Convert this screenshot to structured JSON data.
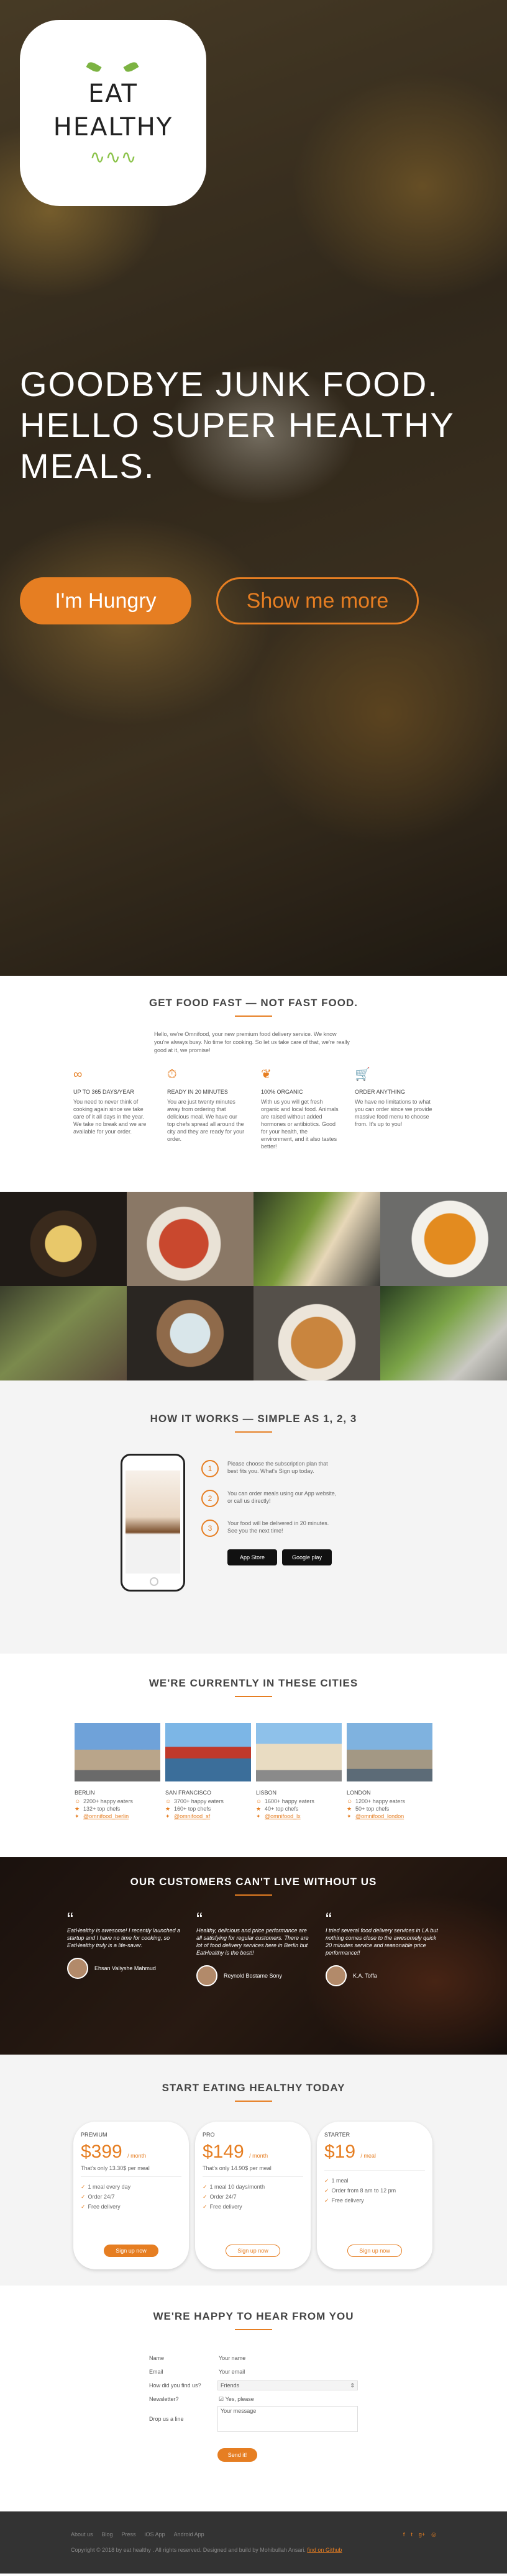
{
  "logo": {
    "line1": "EAT",
    "line2": "HEALTHY"
  },
  "hero": {
    "title": "GOODBYE JUNK FOOD. HELLO SUPER HEALTHY MEALS.",
    "primary_btn": "I'm Hungry",
    "secondary_btn": "Show me more"
  },
  "features": {
    "title": "Get food fast — not fast food.",
    "intro": "Hello, we're Omnifood, your new premium food delivery service. We know you're always busy. No time for cooking. So let us take care of that, we're really good at it, we promise!",
    "items": [
      {
        "icon": "infinity-icon",
        "glyph": "∞",
        "heading": "UP TO 365 DAYS/YEAR",
        "text": "You need to never think of cooking again since we take care of it all days in the year. We take no break and we are available for your order."
      },
      {
        "icon": "stopwatch-icon",
        "glyph": "⏱",
        "heading": "READY IN 20 MINUTES",
        "text": "You are just twenty minutes away from ordering that delicious meal. We have our top chefs spread all around the city and they are ready for your order."
      },
      {
        "icon": "leaf-icon",
        "glyph": "❦",
        "heading": "100% ORGANIC",
        "text": "With us you will get fresh organic and local food. Animals are raised without added hormones or antibiotics. Good for your health, the environment, and it also tastes better!"
      },
      {
        "icon": "cart-icon",
        "glyph": "🛒",
        "heading": "ORDER ANYTHING",
        "text": "We have no limitations to what you can order since we provide massive food menu to choose from. It's up to you!"
      }
    ]
  },
  "how": {
    "title": "How it works — Simple as 1, 2, 3",
    "steps": [
      {
        "num": "1",
        "text": "Please choose the subscription plan that best fits you. What's Sign up today."
      },
      {
        "num": "2",
        "text": "You can order meals using our App website, or call us directly!"
      },
      {
        "num": "3",
        "text": "Your food will be delivered in 20 minutes. See you the next time!"
      }
    ],
    "app_store": "App Store",
    "google_play": "Google play"
  },
  "cities": {
    "title": "We're currently in these cities",
    "items": [
      {
        "name": "BERLIN",
        "users": "2200+ happy eaters",
        "chefs": "132+ top chefs",
        "handle": "@omnifood_berlin"
      },
      {
        "name": "SAN FRANCISCO",
        "users": "3700+ happy eaters",
        "chefs": "160+ top chefs",
        "handle": "@omnifood_sf"
      },
      {
        "name": "LISBON",
        "users": "1600+ happy eaters",
        "chefs": "40+ top chefs",
        "handle": "@omnifood_lx"
      },
      {
        "name": "LONDON",
        "users": "1200+ happy eaters",
        "chefs": "50+ top chefs",
        "handle": "@omnifood_london"
      }
    ]
  },
  "testimonials": {
    "title": "Our customers can't live without us",
    "items": [
      {
        "quote": "EatHealthy is awesome! I recently launched a startup and I have no time for cooking, so EatHealthy truly is a life-saver.",
        "author": "Ehsan Valiyshe Mahmud"
      },
      {
        "quote": "Healthy, delicious and price performance are all satisfying for regular customers. There are lot of food delivery services here in Berlin but EatHealthy is the best!!",
        "author": "Reynold Bostame Sony"
      },
      {
        "quote": "I tried several food delivery services in LA but nothing comes close to the awesomely quick 20 minutes service and reasonable price performance!!",
        "author": "K.A. Toffa"
      }
    ]
  },
  "plans": {
    "title": "Start eating healthy today",
    "items": [
      {
        "name": "PREMIUM",
        "price": "$399",
        "unit": "/ month",
        "per": "That's only 13.30$ per meal",
        "features": [
          "1 meal every day",
          "Order 24/7",
          "Free delivery"
        ],
        "button": "Sign up now",
        "style": "full"
      },
      {
        "name": "PRO",
        "price": "$149",
        "unit": "/ month",
        "per": "That's only 14.90$ per meal",
        "features": [
          "1 meal 10 days/month",
          "Order 24/7",
          "Free delivery"
        ],
        "button": "Sign up now",
        "style": "ghost"
      },
      {
        "name": "STARTER",
        "price": "$19",
        "unit": "/ meal",
        "per": "",
        "features": [
          "1 meal",
          "Order from 8 am to 12 pm",
          "Free delivery"
        ],
        "button": "Sign up now",
        "style": "ghost"
      }
    ]
  },
  "form": {
    "title": "We're happy to hear from you",
    "name_label": "Name",
    "name_placeholder": "Your name",
    "email_label": "Email",
    "email_placeholder": "Your email",
    "find_label": "How did you find us?",
    "find_value": "Friends",
    "newsletter_label": "Newsletter?",
    "newsletter_value": "Yes, please",
    "message_label": "Drop us a line",
    "message_placeholder": "Your message",
    "send": "Send it!"
  },
  "footer": {
    "links": [
      "About us",
      "Blog",
      "Press",
      "iOS App",
      "Android App"
    ],
    "copyright": "Copyright © 2018 by eat healthy . All rights reserved.  Designed and build by Mohibullah Ansari.",
    "github": "find on Github"
  },
  "colors": {
    "accent": "#e67e22",
    "footer_bg": "#333333",
    "section_alt": "#f4f4f4"
  }
}
